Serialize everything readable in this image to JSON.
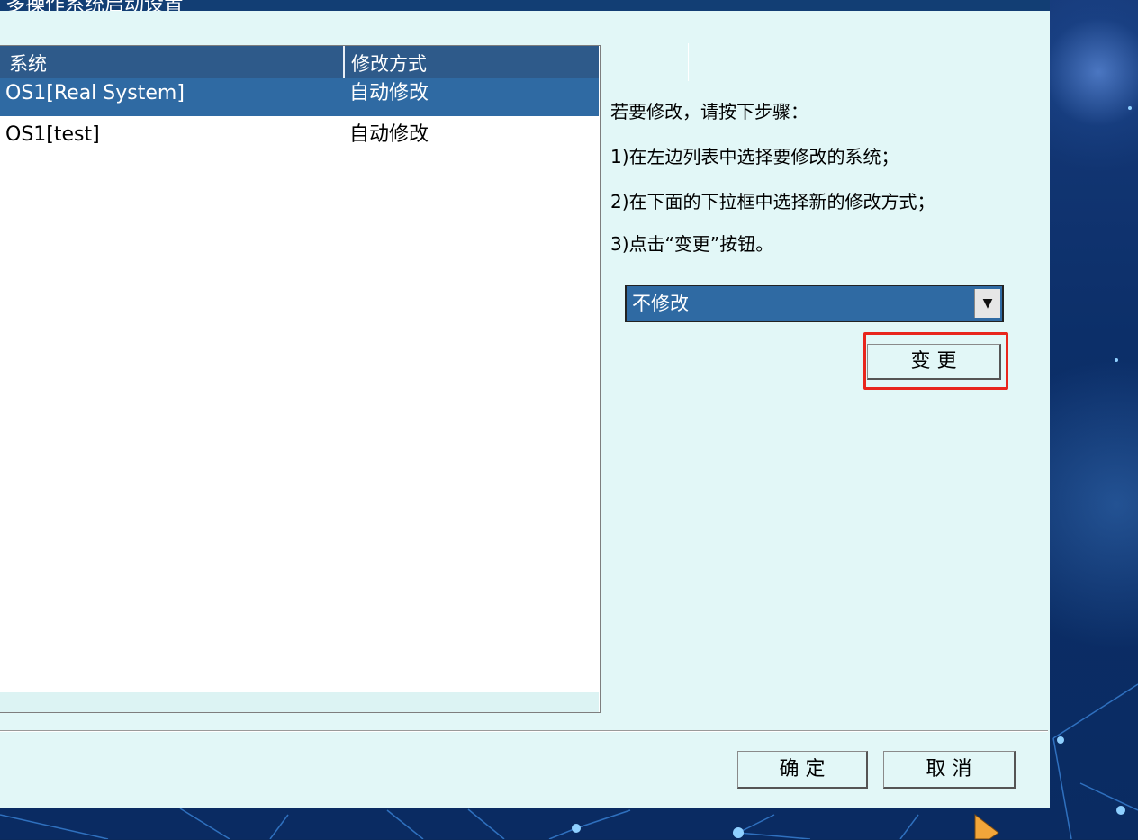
{
  "window": {
    "title": "多操作系统启动设置"
  },
  "list": {
    "columns": [
      "系统",
      "修改方式"
    ],
    "rows": [
      {
        "system": "OS1[Real System]",
        "mode": "自动修改",
        "selected": true
      },
      {
        "system": "OS1[test]",
        "mode": "自动修改",
        "selected": false
      }
    ]
  },
  "instructions": {
    "intro": "若要修改，请按下步骤：",
    "step1": "1)在左边列表中选择要修改的系统；",
    "step2": "2)在下面的下拉框中选择新的修改方式；",
    "step3": "3)点击“变更”按钮。"
  },
  "mode_select": {
    "value": "不修改"
  },
  "buttons": {
    "change": "变 更",
    "ok": "确 定",
    "cancel": "取 消"
  },
  "colors": {
    "selection": "#2f6aa3",
    "highlight": "#e8261d",
    "dialog_bg": "#e2f7f7"
  }
}
